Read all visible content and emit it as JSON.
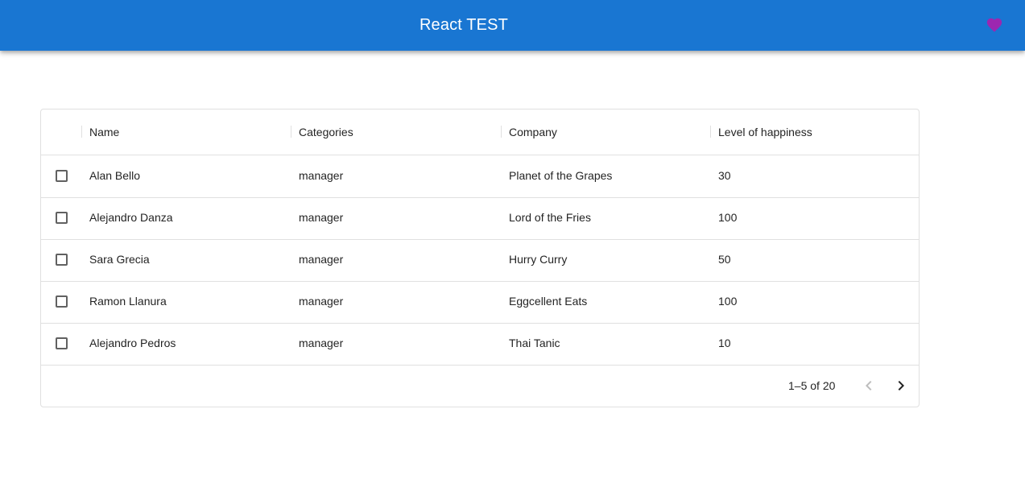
{
  "app": {
    "title": "React TEST",
    "favorite_icon": "heart-icon",
    "accent_color": "#1976d2",
    "icon_color": "#9c27b0"
  },
  "table": {
    "columns": [
      "Name",
      "Categories",
      "Company",
      "Level of happiness"
    ],
    "rows": [
      {
        "name": "Alan Bello",
        "category": "manager",
        "company": "Planet of the Grapes",
        "happiness": "30"
      },
      {
        "name": "Alejandro Danza",
        "category": "manager",
        "company": "Lord of the Fries",
        "happiness": "100"
      },
      {
        "name": "Sara Grecia",
        "category": "manager",
        "company": "Hurry Curry",
        "happiness": "50"
      },
      {
        "name": "Ramon Llanura",
        "category": "manager",
        "company": "Eggcellent Eats",
        "happiness": "100"
      },
      {
        "name": "Alejandro Pedros",
        "category": "manager",
        "company": "Thai Tanic",
        "happiness": "10"
      }
    ]
  },
  "pagination": {
    "range_text": "1–5 of 20",
    "prev_icon": "chevron-left-icon",
    "next_icon": "chevron-right-icon"
  }
}
